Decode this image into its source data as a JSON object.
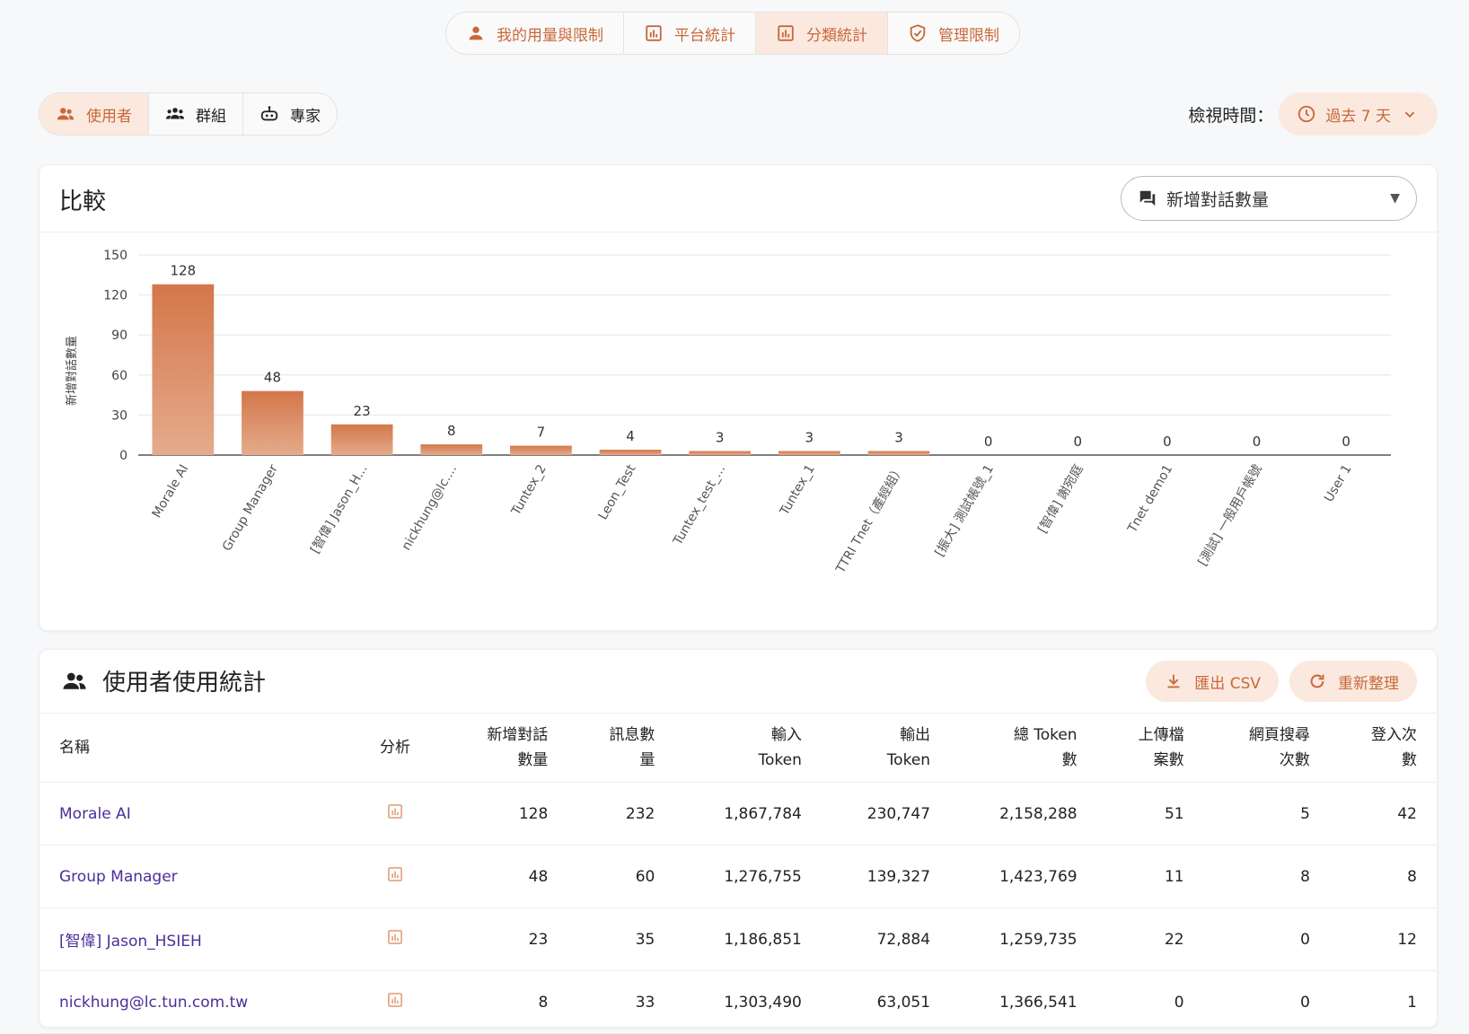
{
  "topnav": {
    "items": [
      {
        "label": "我的用量與限制",
        "icon": "person-icon",
        "active": false
      },
      {
        "label": "平台統計",
        "icon": "bar-chart-icon",
        "active": false
      },
      {
        "label": "分類統計",
        "icon": "bar-chart-icon",
        "active": true
      },
      {
        "label": "管理限制",
        "icon": "shield-check-icon",
        "active": false
      }
    ]
  },
  "segments": {
    "items": [
      {
        "label": "使用者",
        "icon": "users-icon",
        "active": true
      },
      {
        "label": "群組",
        "icon": "group-icon",
        "active": false
      },
      {
        "label": "專家",
        "icon": "robot-icon",
        "active": false
      }
    ]
  },
  "timefilter": {
    "label": "檢視時間：",
    "value": "過去 7 天"
  },
  "compare": {
    "title": "比較",
    "metric": "新增對話數量"
  },
  "accent_color": "#c8683a",
  "chart_data": {
    "type": "bar",
    "ylabel": "新增對話數量",
    "ylim": [
      0,
      150
    ],
    "yticks": [
      0,
      30,
      60,
      90,
      120,
      150
    ],
    "grid": true,
    "categories": [
      "Morale AI",
      "Group Manager",
      "[智偉] Jason_H...",
      "nickhung@lc....",
      "Tuntex_2",
      "Leon_Test",
      "Tuntex_test_...",
      "Tuntex_1",
      "TTRI Tnet（產經組）",
      "[振大] 測試帳號_1",
      "[智偉] 謝宛庭",
      "Tnet demo1",
      "[測試] 一般用戶帳號",
      "User 1"
    ],
    "values": [
      128,
      48,
      23,
      8,
      7,
      4,
      3,
      3,
      3,
      0,
      0,
      0,
      0,
      0
    ]
  },
  "table": {
    "title": "使用者使用統計",
    "export_label": "匯出 CSV",
    "refresh_label": "重新整理",
    "columns": [
      {
        "l1": "名稱",
        "l2": ""
      },
      {
        "l1": "分析",
        "l2": ""
      },
      {
        "l1": "新增對話",
        "l2": "數量"
      },
      {
        "l1": "訊息數",
        "l2": "量"
      },
      {
        "l1": "輸入",
        "l2": "Token"
      },
      {
        "l1": "輸出",
        "l2": "Token"
      },
      {
        "l1": "總 Token",
        "l2": "數"
      },
      {
        "l1": "上傳檔",
        "l2": "案數"
      },
      {
        "l1": "網頁搜尋",
        "l2": "次數"
      },
      {
        "l1": "登入次",
        "l2": "數"
      }
    ],
    "rows": [
      {
        "name": "Morale AI",
        "conv": "128",
        "msg": "232",
        "in": "1,867,784",
        "out": "230,747",
        "total": "2,158,288",
        "files": "51",
        "search": "5",
        "login": "42"
      },
      {
        "name": "Group Manager",
        "conv": "48",
        "msg": "60",
        "in": "1,276,755",
        "out": "139,327",
        "total": "1,423,769",
        "files": "11",
        "search": "8",
        "login": "8"
      },
      {
        "name": "[智偉] Jason_HSIEH",
        "conv": "23",
        "msg": "35",
        "in": "1,186,851",
        "out": "72,884",
        "total": "1,259,735",
        "files": "22",
        "search": "0",
        "login": "12"
      },
      {
        "name": "nickhung@lc.tun.com.tw",
        "conv": "8",
        "msg": "33",
        "in": "1,303,490",
        "out": "63,051",
        "total": "1,366,541",
        "files": "0",
        "search": "0",
        "login": "1"
      }
    ]
  }
}
